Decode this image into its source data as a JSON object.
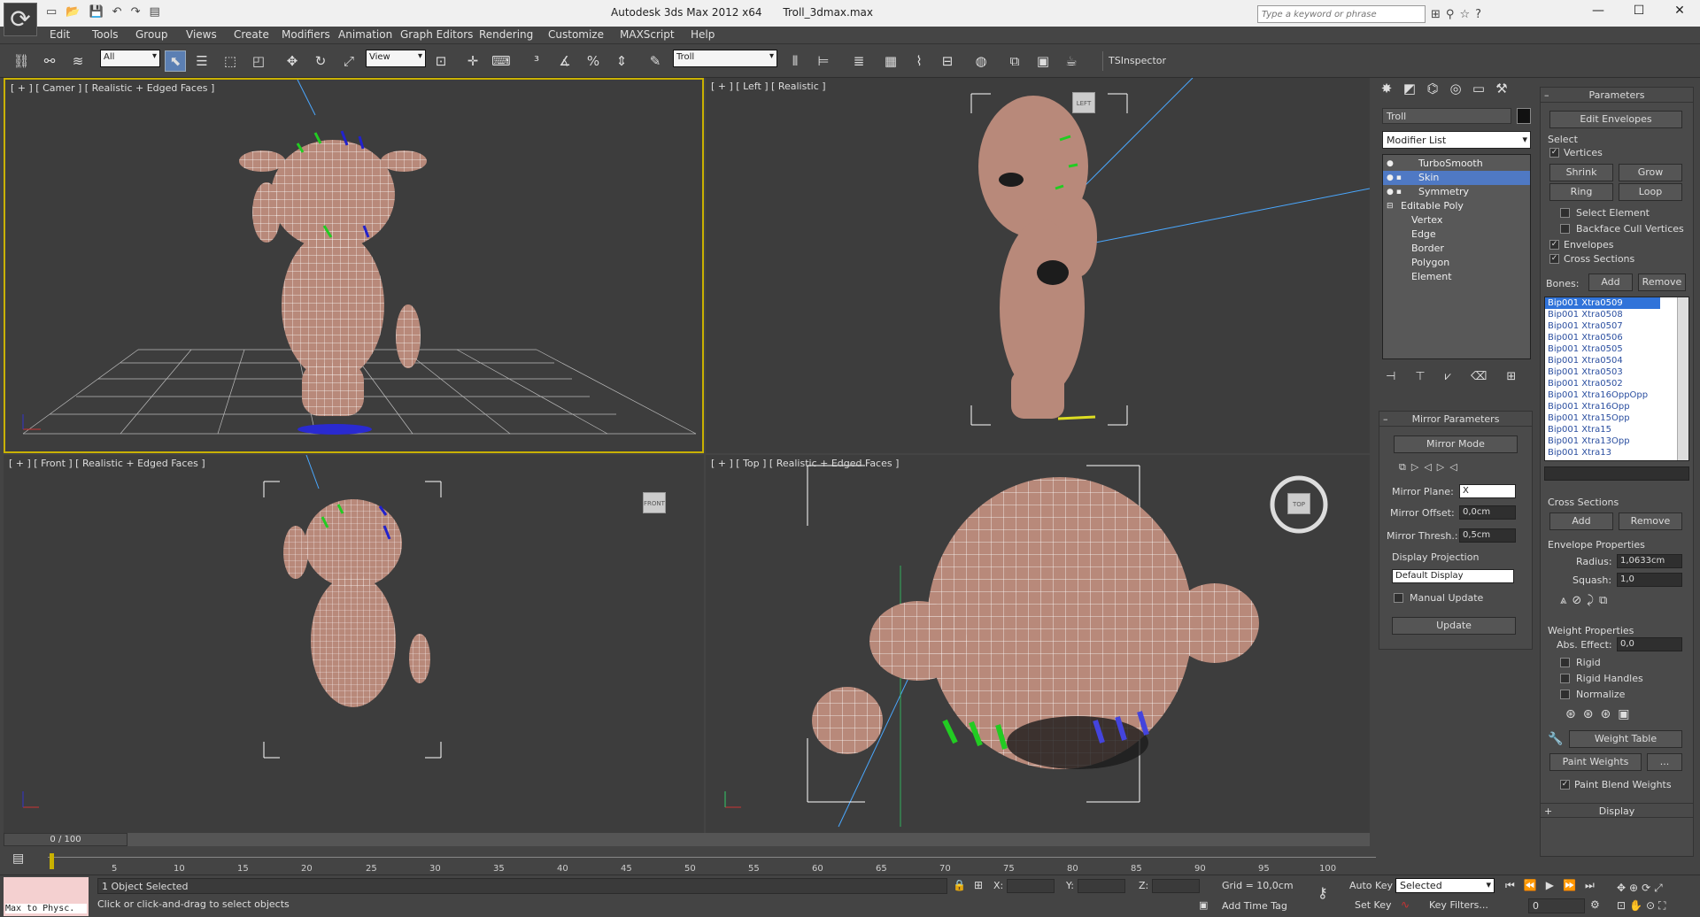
{
  "title_bar": {
    "app": "Autodesk 3ds Max  2012 x64",
    "file": "Troll_3dmax.max",
    "search_placeholder": "Type a keyword or phrase"
  },
  "menu": [
    "Edit",
    "Tools",
    "Group",
    "Views",
    "Create",
    "Modifiers",
    "Animation",
    "Graph Editors",
    "Rendering",
    "Customize",
    "MAXScript",
    "Help"
  ],
  "toolbar": {
    "selection_filter": "All",
    "ref_coord": "View",
    "named_selection": "Troll",
    "tsinspector": "TSInspector"
  },
  "viewports": {
    "perspective": "[ + ] [ Camer ] [ Realistic + Edged Faces ]",
    "left": "[ + ] [ Left ] [ Realistic ]",
    "front": "[ + ] [ Front ] [ Realistic + Edged Faces ]",
    "top": "[ + ] [ Top ] [ Realistic + Edged Faces ]",
    "gizmo_left": "LEFT",
    "gizmo_front": "FRONT",
    "gizmo_top": "TOP"
  },
  "command_panel": {
    "object_name": "Troll",
    "modifier_list": "Modifier List",
    "stack": [
      "TurboSmooth",
      "Skin",
      "Symmetry",
      "Editable Poly",
      "Vertex",
      "Edge",
      "Border",
      "Polygon",
      "Element"
    ],
    "mirror": {
      "title": "Mirror Parameters",
      "mode_btn": "Mirror Mode",
      "plane_label": "Mirror Plane:",
      "plane_value": "X",
      "offset_label": "Mirror Offset:",
      "offset_value": "0,0cm",
      "thresh_label": "Mirror Thresh.:",
      "thresh_value": "0,5cm",
      "display_projection": "Display Projection",
      "display_value": "Default Display",
      "manual_update": "Manual Update",
      "update_btn": "Update"
    },
    "params": {
      "title": "Parameters",
      "edit_envelopes": "Edit Envelopes",
      "select": "Select",
      "vertices": "Vertices",
      "shrink": "Shrink",
      "grow": "Grow",
      "ring": "Ring",
      "loop": "Loop",
      "select_element": "Select Element",
      "backface_cull": "Backface Cull Vertices",
      "envelopes": "Envelopes",
      "cross_sections": "Cross Sections",
      "bones_label": "Bones:",
      "add": "Add",
      "remove": "Remove",
      "bones": [
        "Bip001 Xtra0509",
        "Bip001 Xtra0508",
        "Bip001 Xtra0507",
        "Bip001 Xtra0506",
        "Bip001 Xtra0505",
        "Bip001 Xtra0504",
        "Bip001 Xtra0503",
        "Bip001 Xtra0502",
        "Bip001 Xtra16OppOpp",
        "Bip001 Xtra16Opp",
        "Bip001 Xtra15Opp",
        "Bip001 Xtra15",
        "Bip001 Xtra13Opp",
        "Bip001 Xtra13"
      ],
      "cross_title": "Cross Sections",
      "cs_add": "Add",
      "cs_remove": "Remove",
      "envelope_props": "Envelope Properties",
      "radius_label": "Radius:",
      "radius_value": "1,0633cm",
      "squash_label": "Squash:",
      "squash_value": "1,0",
      "weight_props": "Weight Properties",
      "abs_effect": "Abs. Effect:",
      "abs_value": "0,0",
      "rigid": "Rigid",
      "rigid_handles": "Rigid Handles",
      "normalize": "Normalize",
      "weight_table": "Weight Table",
      "paint_weights": "Paint Weights",
      "paint_dots": "...",
      "paint_blend": "Paint Blend Weights",
      "display": "Display"
    }
  },
  "timeline": {
    "frame_label": "0 / 100",
    "ticks": [
      "5",
      "10",
      "15",
      "20",
      "25",
      "30",
      "35",
      "40",
      "45",
      "50",
      "55",
      "60",
      "65",
      "70",
      "75",
      "80",
      "85",
      "90",
      "95",
      "100"
    ]
  },
  "status": {
    "maxscript": "Max to Physc.",
    "selected": "1 Object Selected",
    "prompt": "Click or click-and-drag to select objects",
    "x": "X:",
    "y": "Y:",
    "z": "Z:",
    "grid": "Grid = 10,0cm",
    "add_time_tag": "Add Time Tag",
    "auto_key": "Auto Key",
    "set_key": "Set Key",
    "selected_drop": "Selected",
    "key_filters": "Key Filters...",
    "frame": "0"
  },
  "colors": {
    "viewport_bg": "#3d3d3d",
    "active_border": "#c9b100",
    "wire": "#ffffff",
    "skin": "#b8897a",
    "selection": "#4f79c4"
  }
}
